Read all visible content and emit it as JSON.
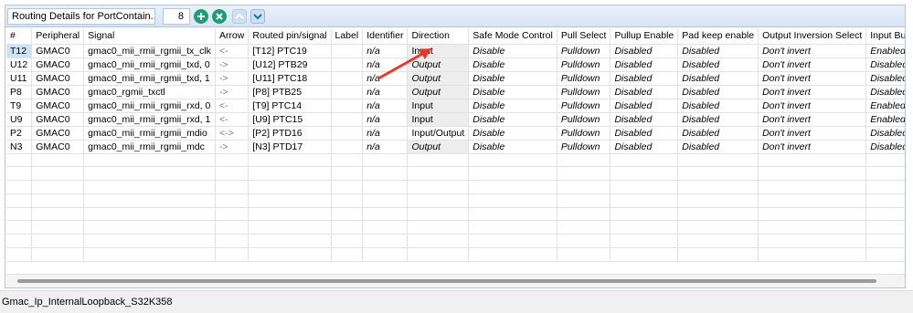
{
  "toolbar": {
    "title": "Routing Details for PortContain...",
    "count": "8"
  },
  "columns": [
    "#",
    "Peripheral",
    "Signal",
    "Arrow",
    "Routed pin/signal",
    "Label",
    "Identifier",
    "Direction",
    "Safe Mode Control",
    "Pull Select",
    "Pullup Enable",
    "Pad keep enable",
    "Output Inversion Select",
    "Input Buff"
  ],
  "rows": [
    [
      "T12",
      "GMAC0",
      "gmac0_mii_rmii_rgmii_tx_clk",
      "<-",
      "[T12] PTC19",
      "",
      "n/a",
      "Input",
      "Disable",
      "Pulldown",
      "Disabled",
      "Disabled",
      "Don't invert",
      "Enabled"
    ],
    [
      "U12",
      "GMAC0",
      "gmac0_mii_rmii_rgmii_txd, 0",
      "->",
      "[U12] PTB29",
      "",
      "n/a",
      "Output",
      "Disable",
      "Pulldown",
      "Disabled",
      "Disabled",
      "Don't invert",
      "Disabled"
    ],
    [
      "U11",
      "GMAC0",
      "gmac0_mii_rmii_rgmii_txd, 1",
      "->",
      "[U11] PTC18",
      "",
      "n/a",
      "Output",
      "Disable",
      "Pulldown",
      "Disabled",
      "Disabled",
      "Don't invert",
      "Disabled"
    ],
    [
      "P8",
      "GMAC0",
      "gmac0_rgmii_txctl",
      "->",
      "[P8] PTB25",
      "",
      "n/a",
      "Output",
      "Disable",
      "Pulldown",
      "Disabled",
      "Disabled",
      "Don't invert",
      "Disabled"
    ],
    [
      "T9",
      "GMAC0",
      "gmac0_mii_rmii_rgmii_rxd, 0",
      "<-",
      "[T9] PTC14",
      "",
      "n/a",
      "Input",
      "Disable",
      "Pulldown",
      "Disabled",
      "Disabled",
      "Don't invert",
      "Enabled"
    ],
    [
      "U9",
      "GMAC0",
      "gmac0_mii_rmii_rgmii_rxd, 1",
      "<-",
      "[U9] PTC15",
      "",
      "n/a",
      "Input",
      "Disable",
      "Pulldown",
      "Disabled",
      "Disabled",
      "Don't invert",
      "Enabled"
    ],
    [
      "P2",
      "GMAC0",
      "gmac0_mii_rmii_rgmii_mdio",
      "<->",
      "[P2] PTD16",
      "",
      "n/a",
      "Input/Output",
      "Disable",
      "Pulldown",
      "Disabled",
      "Disabled",
      "Don't invert",
      "Disabled"
    ],
    [
      "N3",
      "GMAC0",
      "gmac0_mii_rmii_rgmii_mdc",
      "->",
      "[N3] PTD17",
      "",
      "n/a",
      "Output",
      "Disable",
      "Pulldown",
      "Disabled",
      "Disabled",
      "Don't invert",
      "Disabled"
    ]
  ],
  "status": {
    "text": "Gmac_Ip_InternalLoopback_S32K358"
  },
  "icons": {
    "add": "add-icon",
    "remove": "remove-icon",
    "up": "arrow-up-icon",
    "down": "arrow-down-icon"
  },
  "colors": {
    "selected_cell": "#cfe3f7",
    "button_green": "#1f9d72",
    "annotation_arrow": "#e8382b"
  }
}
